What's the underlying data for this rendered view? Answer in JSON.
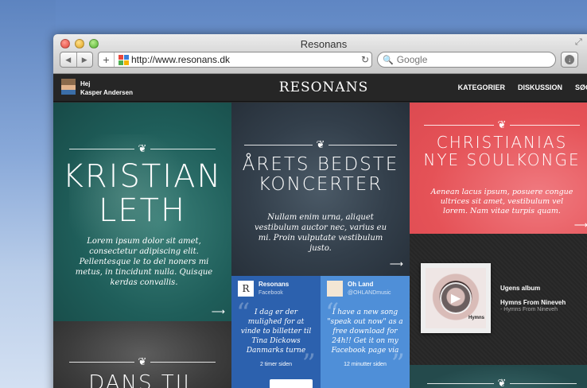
{
  "window": {
    "title": "Resonans"
  },
  "browser": {
    "url": "http://www.resonans.dk",
    "search_placeholder": "Google",
    "nav_back": "◀",
    "nav_forward": "▶",
    "new_tab": "+",
    "reload_icon": "↻",
    "search_icon": "🔍",
    "download_icon": "↓",
    "resize_icon": "⤢"
  },
  "site": {
    "user": {
      "greeting": "Hej",
      "name": "Kasper Andersen"
    },
    "logo": "RESONANS",
    "nav": [
      "KATEGORIER",
      "DISKUSSION",
      "SØG"
    ]
  },
  "ornament_glyph": "❦",
  "arrow_glyph": "⟶",
  "tiles": {
    "kristian": {
      "title_line1": "KRISTIAN",
      "title_line2": "LETH",
      "text": "Lorem ipsum dolor sit amet, consectetur adipiscing elit. Pellentesque le to del noners mi metus, in tincidunt nulla. Quisque kerdas convallis."
    },
    "koncerter": {
      "title_line1": "ÅRETS BEDSTE",
      "title_line2": "KONCERTER",
      "text": "Nullam enim urna, aliquet vestibulum auctor nec, varius eu mi. Proin vulputate vestibulum justo."
    },
    "christianias": {
      "title_line1": "CHRISTIANIAS",
      "title_line2": "NYE SOULKONGE",
      "text": "Aenean lacus ipsum, posuere congue ultrices sit amet, vestibulum vel lorem. Nam vitae turpis quam."
    },
    "dans": {
      "title": "DANS TIL"
    },
    "facebook": {
      "icon_letter": "R",
      "name": "Resonans",
      "source": "Facebook",
      "text": "I dag er der mulighed for at vinde to billetter til Tina Dickows Danmarks turne",
      "time": "2 timer siden"
    },
    "twitter": {
      "name": "Oh Land",
      "handle": "@OHLANDmusic",
      "text": "I have a new song \"speak out now\" as a free download for 24h!! Get it on my Facebook page via",
      "time": "12 minutter siden"
    },
    "album": {
      "label": "Ugens album",
      "title": "Hymns From Nineveh",
      "track": "- Hymns From Nineveh",
      "cover_text": "Hymns",
      "play_icon": "▶"
    }
  },
  "colors": {
    "teal": "#1f5e5a",
    "coral": "#e55257",
    "facebook_blue": "#2c61ae",
    "twitter_blue": "#4f8fd8",
    "header_dark": "#262626"
  }
}
